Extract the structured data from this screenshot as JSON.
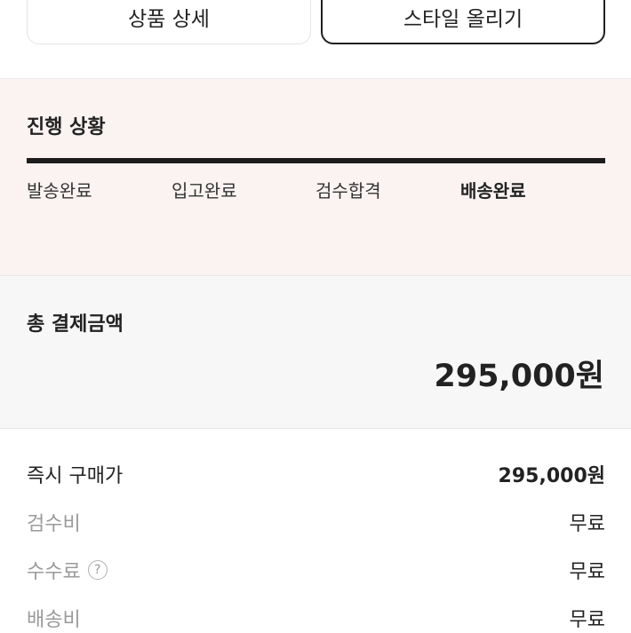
{
  "top_buttons": {
    "product_detail": "상품 상세",
    "upload_style": "스타일 올리기"
  },
  "progress": {
    "title": "진행 상황",
    "steps": [
      "발송완료",
      "입고완료",
      "검수합격",
      "배송완료"
    ],
    "current_step": "배송완료",
    "completion": 1.0
  },
  "total": {
    "label": "총 결제금액",
    "amount": "295,000원"
  },
  "breakdown": [
    {
      "label": "즉시 구매가",
      "value": "295,000원"
    },
    {
      "label": "검수비",
      "value": "무료"
    },
    {
      "label": "수수료",
      "value": "무료",
      "help": "?"
    },
    {
      "label": "배송비",
      "value": "무료"
    }
  ],
  "colors": {
    "progress_bg": "#fbf3f2",
    "total_bg": "#f7f7f7",
    "progress_bar": "#1c1c1c",
    "muted_text": "#9a9a9a"
  },
  "icons": {
    "help": "question-circle-icon"
  }
}
